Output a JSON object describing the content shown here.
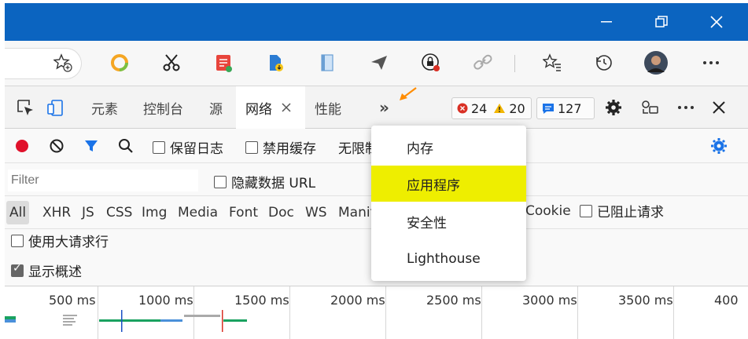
{
  "devtools_tabs": {
    "elements": "元素",
    "console": "控制台",
    "sources": "源",
    "network": "网络",
    "performance": "性能",
    "more": "»"
  },
  "badges": {
    "errors": "24",
    "warnings": "20",
    "messages": "127"
  },
  "toolbar": {
    "preserve_log": "保留日志",
    "disable_cache": "禁用缓存",
    "throttling": "无限制"
  },
  "filter": {
    "placeholder": "Filter",
    "hide_data_urls": "隐藏数据 URL"
  },
  "types": [
    "All",
    "XHR",
    "JS",
    "CSS",
    "Img",
    "Media",
    "Font",
    "Doc",
    "WS",
    "Manifest"
  ],
  "type_extras": {
    "cookies": "Cookie",
    "blocked": "已阻止请求"
  },
  "options": {
    "big_rows": "使用大请求行",
    "overview": "显示概述"
  },
  "timeline_ticks": [
    "500 ms",
    "1000 ms",
    "1500 ms",
    "2000 ms",
    "2500 ms",
    "3000 ms",
    "3500 ms",
    "400"
  ],
  "menu": {
    "items": [
      "内存",
      "应用程序",
      "安全性",
      "Lighthouse"
    ],
    "highlighted_index": 1,
    "highlight_color": "#eeee00"
  },
  "colors": {
    "titlebar": "#0b64c0",
    "accent": "#1a73e8",
    "arrow": "#ff8c00"
  }
}
